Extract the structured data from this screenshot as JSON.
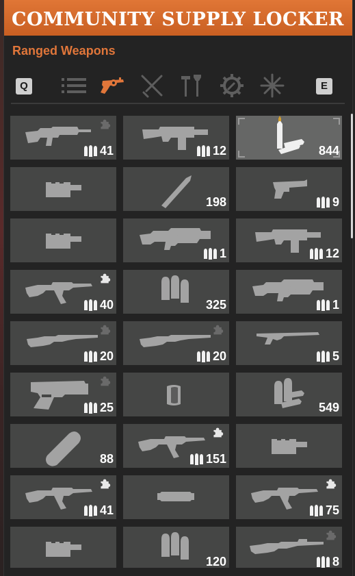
{
  "header": {
    "title": "COMMUNITY SUPPLY LOCKER",
    "accent": "#d9692b"
  },
  "category": {
    "label": "Ranged Weapons"
  },
  "tabs": {
    "prev_key": "Q",
    "next_key": "E",
    "items": [
      {
        "icon": "list-icon",
        "active": false
      },
      {
        "icon": "revolver-icon",
        "active": true
      },
      {
        "icon": "crossed-melee-icon",
        "active": false
      },
      {
        "icon": "tools-icon",
        "active": false
      },
      {
        "icon": "gear-icon",
        "active": false
      },
      {
        "icon": "asterisk-icon",
        "active": false
      }
    ]
  },
  "items": [
    {
      "name": "assault-rifle",
      "icon": "assault-rifle-icon",
      "count": "41",
      "ammo": true,
      "mod": true,
      "selected": false
    },
    {
      "name": "combat-shotgun",
      "icon": "shotgun-drum-icon",
      "count": "12",
      "ammo": true,
      "mod": false,
      "selected": false
    },
    {
      "name": "rifle-cartridges",
      "icon": "cartridges-icon",
      "count": "844",
      "ammo": false,
      "mod": false,
      "selected": true
    },
    {
      "name": "suppressor-a",
      "icon": "suppressor-icon",
      "count": "",
      "ammo": false,
      "mod": false,
      "selected": false
    },
    {
      "name": "single-round",
      "icon": "round-icon",
      "count": "198",
      "ammo": false,
      "mod": false,
      "selected": false
    },
    {
      "name": "pistol",
      "icon": "pistol-icon",
      "count": "9",
      "ammo": true,
      "mod": false,
      "selected": false
    },
    {
      "name": "suppressor-b",
      "icon": "suppressor-icon",
      "count": "",
      "ammo": false,
      "mod": false,
      "selected": false
    },
    {
      "name": "grenade-launcher-a",
      "icon": "launcher-icon",
      "count": "1",
      "ammo": true,
      "mod": false,
      "selected": false
    },
    {
      "name": "combat-shotgun-b",
      "icon": "shotgun-drum-icon",
      "count": "12",
      "ammo": true,
      "mod": false,
      "selected": false
    },
    {
      "name": "ak-rifle-a",
      "icon": "ak-rifle-icon",
      "count": "40",
      "ammo": true,
      "mod": true,
      "selected": false
    },
    {
      "name": "shotgun-shells",
      "icon": "shells-icon",
      "count": "325",
      "ammo": false,
      "mod": false,
      "selected": false
    },
    {
      "name": "grenade-launcher-b",
      "icon": "launcher-icon",
      "count": "1",
      "ammo": true,
      "mod": false,
      "selected": false
    },
    {
      "name": "hunting-rifle-a",
      "icon": "long-rifle-icon",
      "count": "20",
      "ammo": true,
      "mod": true,
      "selected": false
    },
    {
      "name": "hunting-rifle-b",
      "icon": "long-rifle-icon",
      "count": "20",
      "ammo": true,
      "mod": true,
      "selected": false
    },
    {
      "name": "sawed-shotgun",
      "icon": "short-shotgun-icon",
      "count": "5",
      "ammo": true,
      "mod": false,
      "selected": false
    },
    {
      "name": "heavy-pistol",
      "icon": "heavy-pistol-icon",
      "count": "25",
      "ammo": true,
      "mod": true,
      "selected": false
    },
    {
      "name": "scope-ring",
      "icon": "ring-icon",
      "count": "",
      "ammo": false,
      "mod": false,
      "selected": false
    },
    {
      "name": "pistol-rounds",
      "icon": "bullets-pile-icon",
      "count": "549",
      "ammo": false,
      "mod": false,
      "selected": false
    },
    {
      "name": "grenade-round",
      "icon": "grenade-round-icon",
      "count": "88",
      "ammo": false,
      "mod": false,
      "selected": false
    },
    {
      "name": "ak-rifle-b",
      "icon": "ak-rifle-icon",
      "count": "151",
      "ammo": true,
      "mod": true,
      "selected": false
    },
    {
      "name": "suppressor-c",
      "icon": "suppressor-icon",
      "count": "",
      "ammo": false,
      "mod": false,
      "selected": false
    },
    {
      "name": "ak-rifle-c",
      "icon": "ak-rifle-icon",
      "count": "41",
      "ammo": true,
      "mod": true,
      "selected": false
    },
    {
      "name": "silencer-tube",
      "icon": "tube-icon",
      "count": "",
      "ammo": false,
      "mod": false,
      "selected": false
    },
    {
      "name": "ak-rifle-d",
      "icon": "ak-rifle-icon",
      "count": "75",
      "ammo": true,
      "mod": true,
      "selected": false
    },
    {
      "name": "suppressor-d",
      "icon": "suppressor-icon",
      "count": "",
      "ammo": false,
      "mod": false,
      "selected": false
    },
    {
      "name": "magnum-rounds",
      "icon": "shells-icon",
      "count": "120",
      "ammo": false,
      "mod": false,
      "selected": false
    },
    {
      "name": "sniper-rifle",
      "icon": "sniper-icon",
      "count": "8",
      "ammo": true,
      "mod": true,
      "selected": false
    }
  ]
}
